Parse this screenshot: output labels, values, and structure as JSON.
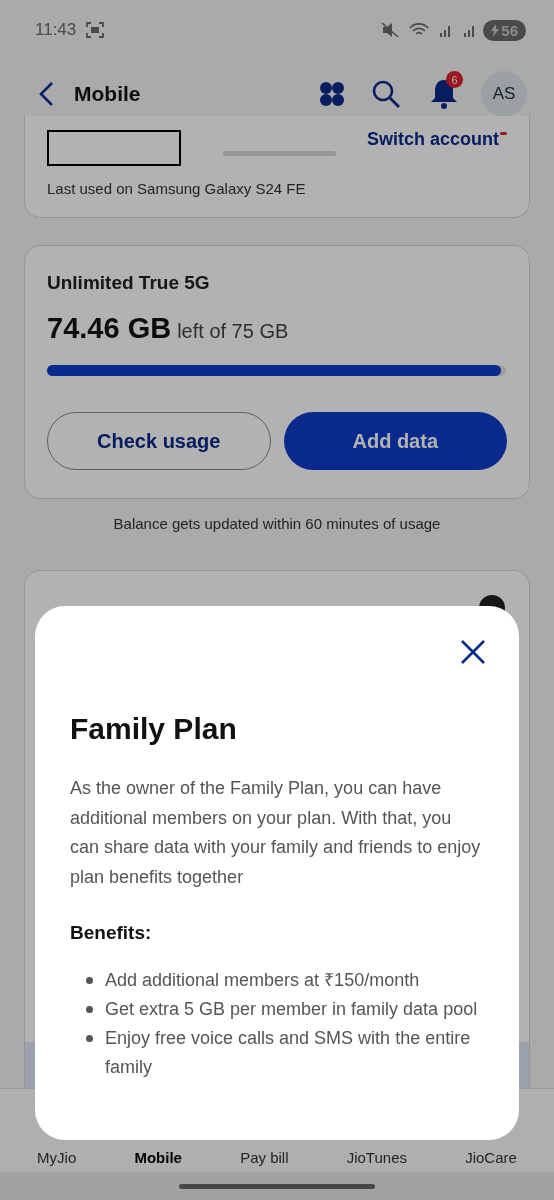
{
  "status_bar": {
    "time": "11:43",
    "battery": "56"
  },
  "header": {
    "title": "Mobile",
    "notification_count": "6",
    "avatar": "AS"
  },
  "account": {
    "switch_label": "Switch account",
    "last_used": "Last used on Samsung Galaxy S24 FE"
  },
  "usage": {
    "plan": "Unlimited True 5G",
    "remaining": "74.46 GB",
    "total_text": "left of 75 GB",
    "level": 0.99,
    "buttons": [
      {
        "label": "Check usage",
        "kind": "outline"
      },
      {
        "label": "Add data",
        "kind": "filled"
      }
    ]
  },
  "note": "Balance gets updated within 60 minutes of usage",
  "sheet": {
    "title": "Family Plan",
    "description": "As the owner of the Family Plan, you can have additional members on your plan. With that, you can share data with your family and friends to enjoy plan benefits together",
    "benefits_heading": "Benefits:",
    "benefits": [
      "Add additional members at ₹150/month",
      "Get extra 5 GB per member in family data pool",
      "Enjoy free voice calls and SMS with the entire family"
    ]
  },
  "bottom_nav": [
    {
      "label": "MyJio",
      "selected": false
    },
    {
      "label": "Mobile",
      "selected": true
    },
    {
      "label": "Pay bill",
      "selected": false
    },
    {
      "label": "JioTunes",
      "selected": false
    },
    {
      "label": "JioCare",
      "selected": false
    }
  ]
}
